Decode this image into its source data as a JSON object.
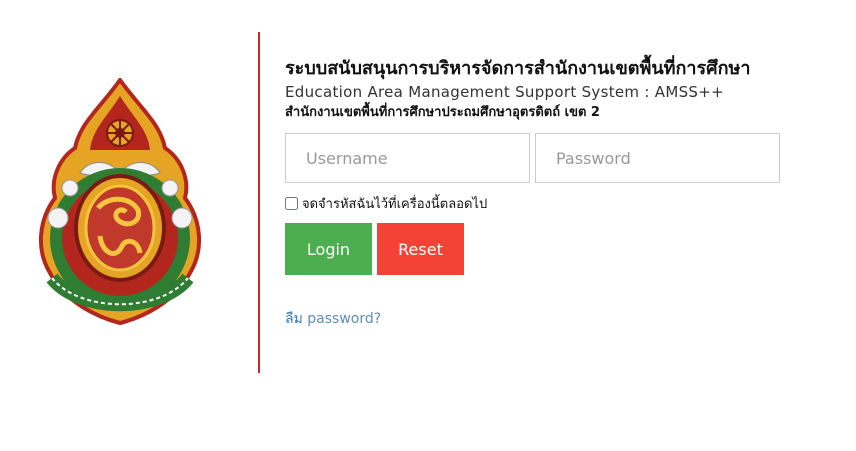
{
  "header": {
    "title_th": "ระบบสนับสนุนการบริหารจัดการสำนักงานเขตพื้นที่การศึกษา",
    "title_en": "Education Area Management Support System : AMSS++",
    "office_name": "สำนักงานเขตพื้นที่การศึกษาประถมศึกษาอุตรดิตถ์ เขต 2"
  },
  "logo": {
    "icon": "obec-emblem-icon",
    "colors": {
      "gold": "#e6a424",
      "red": "#b3261e",
      "green": "#2e7d32",
      "white": "#ffffff"
    }
  },
  "form": {
    "username_placeholder": "Username",
    "username_value": "",
    "password_placeholder": "Password",
    "password_value": "",
    "remember_label": "จดจำรหัสฉันไว้ที่เครื่องนี้ตลอดไป",
    "remember_checked": false,
    "login_label": "Login",
    "reset_label": "Reset",
    "forgot_prefix": "ลืม",
    "forgot_link": "password?"
  },
  "colors": {
    "divider": "#c62828",
    "login_button": "#4cae4f",
    "reset_button": "#f44336",
    "link": "#337ab7"
  }
}
